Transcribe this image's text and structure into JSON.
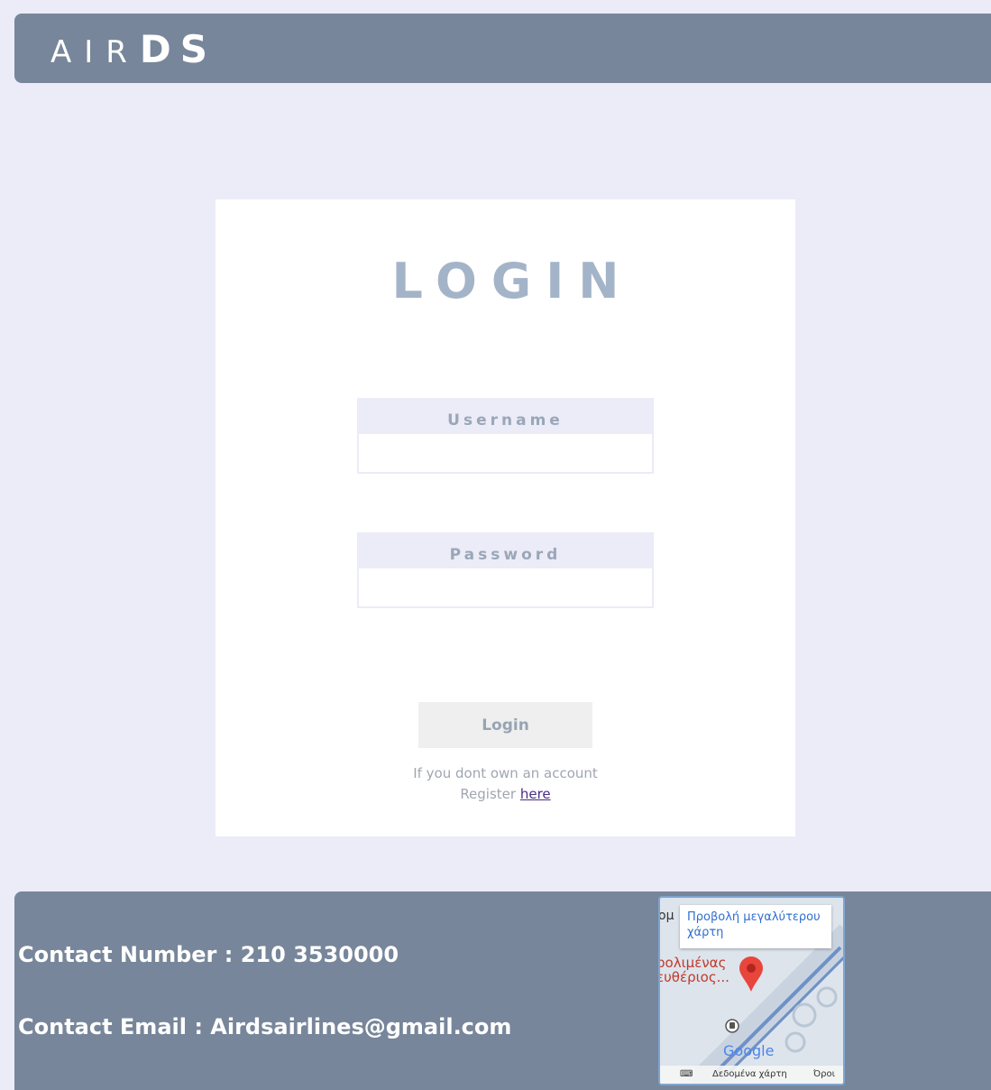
{
  "header": {
    "logo_light": "AIR",
    "logo_bold": "DS"
  },
  "login_card": {
    "title": "LOGIN",
    "username_label": "Username",
    "password_label": "Password",
    "login_button": "Login",
    "register_line1": "If you dont own an account",
    "register_prefix": "Register",
    "register_link": "here"
  },
  "footer": {
    "contact_number": "Contact Number : 210 3530000",
    "contact_email": "Contact Email : Airdsairlines@gmail.com"
  },
  "map": {
    "popup_text": "Προβολή μεγαλύτερου χάρτη",
    "place_label_top": "ομ",
    "place_label": "ρολιμένας\nευθέριος...",
    "google_label": "Google",
    "data_label": "Δεδομένα χάρτη",
    "terms_label": "Όροι",
    "colors": {
      "pin": "#e8453c",
      "road": "#6f90c8"
    }
  }
}
